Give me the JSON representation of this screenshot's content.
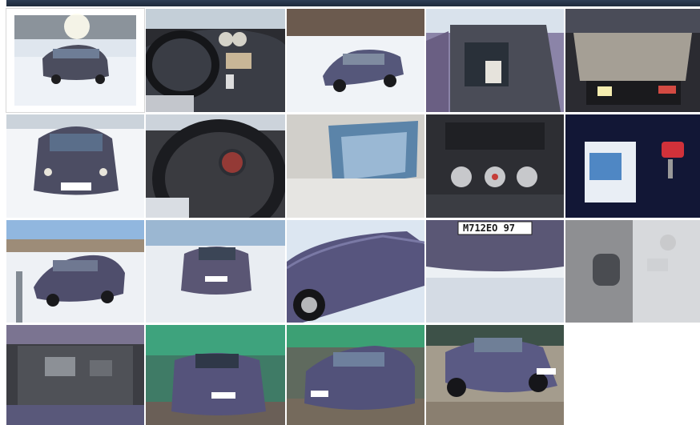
{
  "gallery": {
    "top_strip": "photo-strip",
    "rows": [
      [
        {
          "name": "car-front-snow-sunlight",
          "selected": true
        },
        {
          "name": "dashboard-interior"
        },
        {
          "name": "car-side-snow"
        },
        {
          "name": "open-door-interior"
        },
        {
          "name": "trunk-open"
        }
      ],
      [
        {
          "name": "car-front-snow"
        },
        {
          "name": "steering-wheel-gauges"
        },
        {
          "name": "sunroof"
        },
        {
          "name": "climate-controls"
        },
        {
          "name": "manuals-and-key"
        }
      ],
      [
        {
          "name": "car-rear-three-quarter"
        },
        {
          "name": "car-rear"
        },
        {
          "name": "car-side-doors"
        },
        {
          "name": "rear-bumper-plate",
          "plate": "М712ЕО 97"
        },
        {
          "name": "door-panel-interior"
        }
      ],
      [
        {
          "name": "engine-bay"
        },
        {
          "name": "car-rear-garage"
        },
        {
          "name": "car-front-garage"
        },
        {
          "name": "car-front-garage-2"
        }
      ]
    ]
  }
}
